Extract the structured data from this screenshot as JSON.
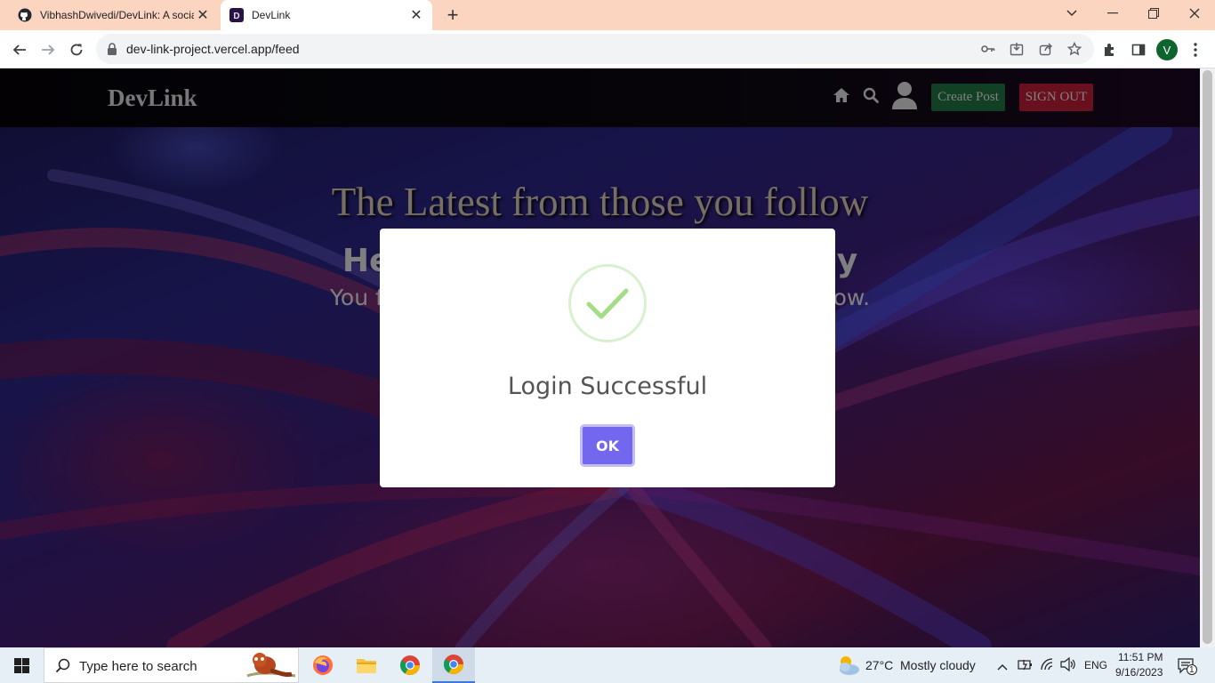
{
  "browser": {
    "tabs": [
      {
        "title": "VibhashDwivedi/DevLink: A socia",
        "active": false,
        "favicon": "github-icon"
      },
      {
        "title": "DevLink",
        "active": true,
        "favicon": "devlink-icon"
      }
    ],
    "url": "dev-link-project.vercel.app/feed",
    "profile_initial": "V"
  },
  "navbar": {
    "brand": "DevLink",
    "create_post_label": "Create Post",
    "sign_out_label": "SIGN OUT",
    "create_post_color": "#1e6b3c",
    "sign_out_color": "#b01c33"
  },
  "feed": {
    "title": "The Latest from those you follow",
    "greeting": "He                                        y",
    "subtitle": "You fee                                                       follow."
  },
  "modal": {
    "icon": "success-check-icon",
    "title": "Login Successful",
    "ok_label": "OK",
    "ok_color": "#7367f0"
  },
  "taskbar": {
    "search_placeholder": "Type here to search",
    "weather_temp": "27°C",
    "weather_desc": "Mostly cloudy",
    "language": "ENG",
    "time": "11:51 PM",
    "date": "9/16/2023",
    "notification_count": "1"
  }
}
